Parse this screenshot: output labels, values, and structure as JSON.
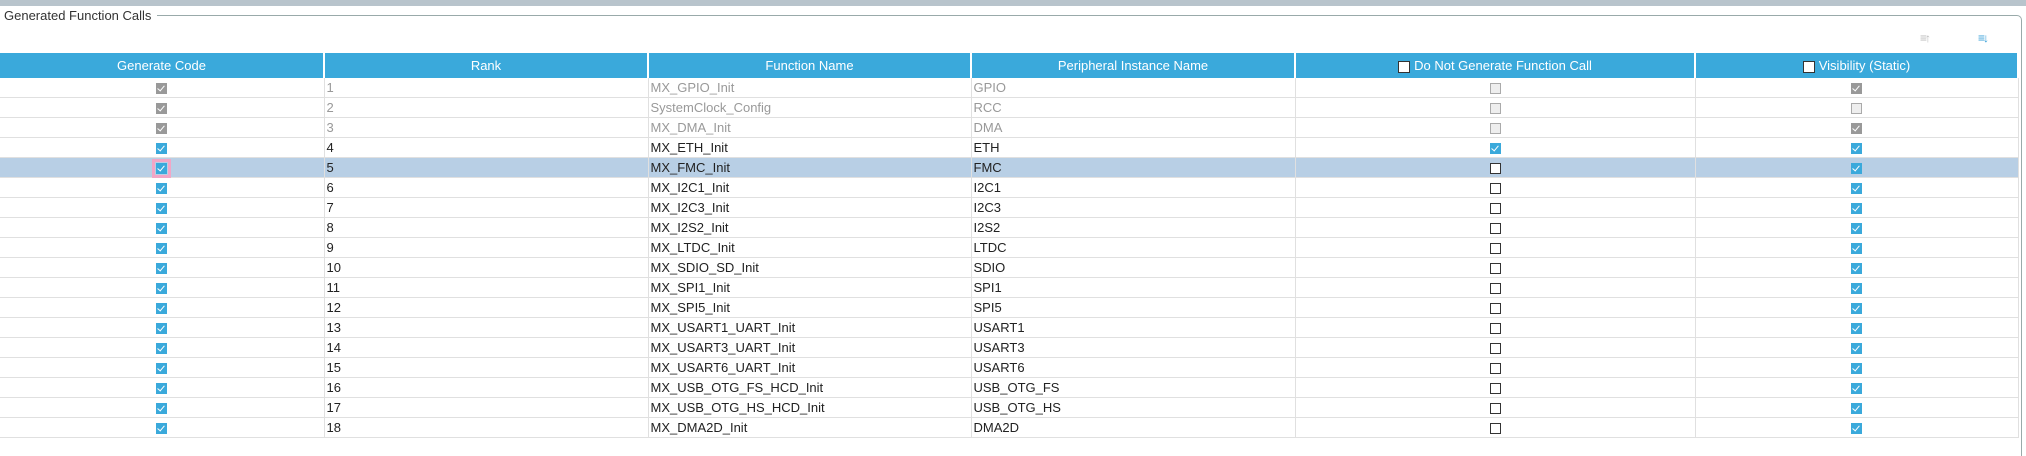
{
  "group_title": "Generated Function Calls",
  "toolbar": {
    "sort_up_icon": "sort-ascending-icon",
    "sort_down_icon": "sort-descending-icon"
  },
  "columns": [
    "Generate Code",
    "Rank",
    "Function Name",
    "Peripheral Instance Name",
    "Do Not Generate Function Call",
    "Visibility (Static)"
  ],
  "header_checkboxes": {
    "do_not_generate": false,
    "visibility": false
  },
  "rows": [
    {
      "generate": true,
      "rank": "1",
      "func": "MX_GPIO_Init",
      "periph": "GPIO",
      "dng": false,
      "vis": true,
      "disabled": true
    },
    {
      "generate": true,
      "rank": "2",
      "func": "SystemClock_Config",
      "periph": "RCC",
      "dng": false,
      "vis": false,
      "disabled": true
    },
    {
      "generate": true,
      "rank": "3",
      "func": "MX_DMA_Init",
      "periph": "DMA",
      "dng": false,
      "vis": true,
      "disabled": true
    },
    {
      "generate": true,
      "rank": "4",
      "func": "MX_ETH_Init",
      "periph": "ETH",
      "dng": true,
      "vis": true
    },
    {
      "generate": true,
      "rank": "5",
      "func": "MX_FMC_Init",
      "periph": "FMC",
      "dng": false,
      "vis": true,
      "selected": true
    },
    {
      "generate": true,
      "rank": "6",
      "func": "MX_I2C1_Init",
      "periph": "I2C1",
      "dng": false,
      "vis": true
    },
    {
      "generate": true,
      "rank": "7",
      "func": "MX_I2C3_Init",
      "periph": "I2C3",
      "dng": false,
      "vis": true
    },
    {
      "generate": true,
      "rank": "8",
      "func": "MX_I2S2_Init",
      "periph": "I2S2",
      "dng": false,
      "vis": true
    },
    {
      "generate": true,
      "rank": "9",
      "func": "MX_LTDC_Init",
      "periph": "LTDC",
      "dng": false,
      "vis": true
    },
    {
      "generate": true,
      "rank": "10",
      "func": "MX_SDIO_SD_Init",
      "periph": "SDIO",
      "dng": false,
      "vis": true
    },
    {
      "generate": true,
      "rank": "11",
      "func": "MX_SPI1_Init",
      "periph": "SPI1",
      "dng": false,
      "vis": true
    },
    {
      "generate": true,
      "rank": "12",
      "func": "MX_SPI5_Init",
      "periph": "SPI5",
      "dng": false,
      "vis": true
    },
    {
      "generate": true,
      "rank": "13",
      "func": "MX_USART1_UART_Init",
      "periph": "USART1",
      "dng": false,
      "vis": true
    },
    {
      "generate": true,
      "rank": "14",
      "func": "MX_USART3_UART_Init",
      "periph": "USART3",
      "dng": false,
      "vis": true
    },
    {
      "generate": true,
      "rank": "15",
      "func": "MX_USART6_UART_Init",
      "periph": "USART6",
      "dng": false,
      "vis": true
    },
    {
      "generate": true,
      "rank": "16",
      "func": "MX_USB_OTG_FS_HCD_Init",
      "periph": "USB_OTG_FS",
      "dng": false,
      "vis": true
    },
    {
      "generate": true,
      "rank": "17",
      "func": "MX_USB_OTG_HS_HCD_Init",
      "periph": "USB_OTG_HS",
      "dng": false,
      "vis": true
    },
    {
      "generate": true,
      "rank": "18",
      "func": "MX_DMA2D_Init",
      "periph": "DMA2D",
      "dng": false,
      "vis": true
    }
  ],
  "colors": {
    "header": "#3aa9db",
    "selected_row": "#b8cfe5",
    "checkbox": "#3aa9db"
  }
}
